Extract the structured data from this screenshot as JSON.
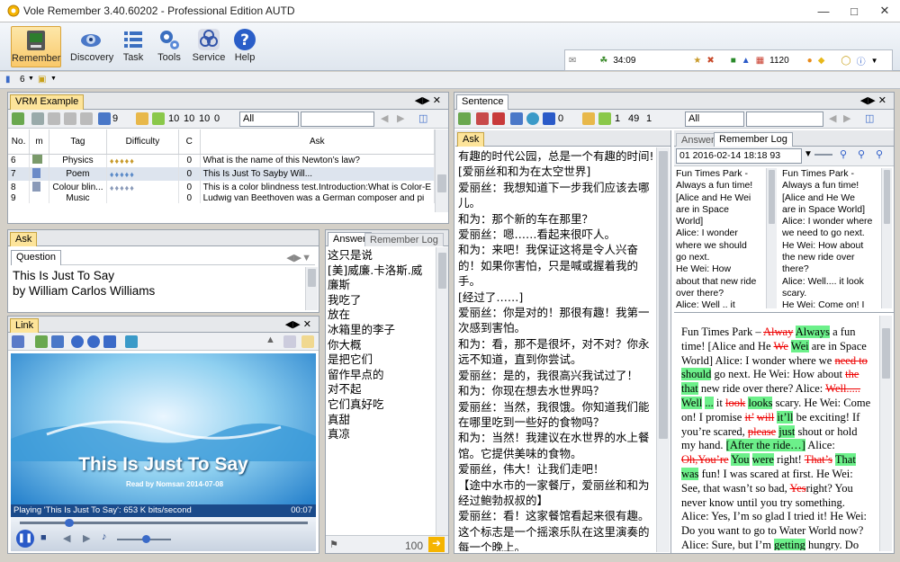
{
  "app": {
    "title": "Vole Remember  3.40.60202 - Professional Edition AUTD"
  },
  "ribbon": {
    "items": [
      "Remember",
      "Discovery",
      "Task",
      "Tools",
      "Service",
      "Help"
    ]
  },
  "status": {
    "time": "34:09",
    "count": "1120"
  },
  "subbar": {
    "count": "6"
  },
  "vrm": {
    "tab": "VRM Example",
    "filter": "All",
    "counts": [
      "9",
      "10",
      "10",
      "10",
      "0"
    ],
    "columns": [
      "No.",
      "m",
      "Tag",
      "Difficulty",
      "C",
      "Ask"
    ],
    "rows": [
      {
        "no": "6",
        "tag": "Physics",
        "c": "0",
        "ask": "What is the name of this Newton’s law?"
      },
      {
        "no": "7",
        "tag": "Poem",
        "c": "0",
        "ask": "This Is Just To Sayby Will..."
      },
      {
        "no": "8",
        "tag": "Colour blin...",
        "c": "0",
        "ask": "This is a color blindness test.Introduction:What is Color-E"
      },
      {
        "no": "9",
        "tag": "Music",
        "c": "0",
        "ask": "Ludwig van Beethoven was a German composer and pi"
      }
    ]
  },
  "ask": {
    "tab": "Ask",
    "question_tab": "Question",
    "question_lines": [
      "This Is Just To Say",
      "by William Carlos Williams"
    ]
  },
  "link": {
    "tab": "Link",
    "video_title": "This Is Just To Say",
    "video_sub": "Read by Nomsan 2014-07-08",
    "playing": "Playing 'This Is Just To Say': 653 K bits/second",
    "time": "00:07"
  },
  "answer_left": {
    "tab1": "Answer",
    "tab2": "Remember Log",
    "lines": [
      "这只是说",
      "[美]威廉.卡洛斯.威",
      "廉斯",
      "我吃了",
      "放在",
      "冰箱里的李子",
      "你大概",
      "是把它们",
      "留作早点的",
      "对不起",
      "它们真好吃",
      "真甜",
      "真凉"
    ],
    "footer": "100"
  },
  "sentence": {
    "tab": "Sentence",
    "filter": "All",
    "counts": [
      "0",
      "1",
      "49",
      "1"
    ],
    "ask_tab": "Ask",
    "lines": [
      "有趣的时代公园，总是一个有趣的时间!",
      "[爱丽丝和和为在太空世界]",
      "爱丽丝：我想知道下一步我们应该去哪儿。",
      "和为：那个新的车在那里？",
      "爱丽丝：嗯……看起来很吓人。",
      "和为：来吧！我保证这将是令人兴奋的！如果你害怕，只是喊或握着我的手。",
      "[经过了……]",
      "爱丽丝：你是对的！那很有趣！我第一次感到害怕。",
      "和为：看，那不是很坏，对不对？你永远不知道，直到你尝试。",
      "爱丽丝：是的，我很高兴我试过了！",
      "和为：你现在想去水世界吗？",
      "爱丽丝：当然，我很饿。你知道我们能在哪里吃到一些好的食物吗？",
      "和为：当然！我建议在水世界的水上餐馆。它提供美味的食物。",
      "爱丽丝，伟大！让我们走吧！",
      "【途中水市的一家餐厅，爱丽丝和和为经过鲍勃叔叔的】",
      "爱丽丝：看！这家餐馆看起来很有趣。这个标志是一个摇滚乐队在这里演奏的每一个晚上。"
    ]
  },
  "answer_right": {
    "tab1": "Answer",
    "tab2": "Remember Log",
    "log_entry": "01 2016-02-14 18:18 93",
    "col1": [
      "Fun Times Park -",
      "Always a fun time!",
      "[Alice and He Wei",
      "are in Space",
      "World]",
      "Alice: I wonder",
      "where we should",
      "go next.",
      "He Wei: How",
      "about that new ride",
      "over there?",
      "Alice: Well .. it"
    ],
    "col2": [
      "Fun Times Park -",
      "Always a fun time!",
      "[Alice and He We",
      "are in Space World]",
      "Alice: I wonder where",
      "we need to go next.",
      "He Wei: How about",
      "the new ride over",
      "there?",
      "Alice: Well.... it look",
      "scary.",
      "He Wei: Come on! I"
    ]
  }
}
